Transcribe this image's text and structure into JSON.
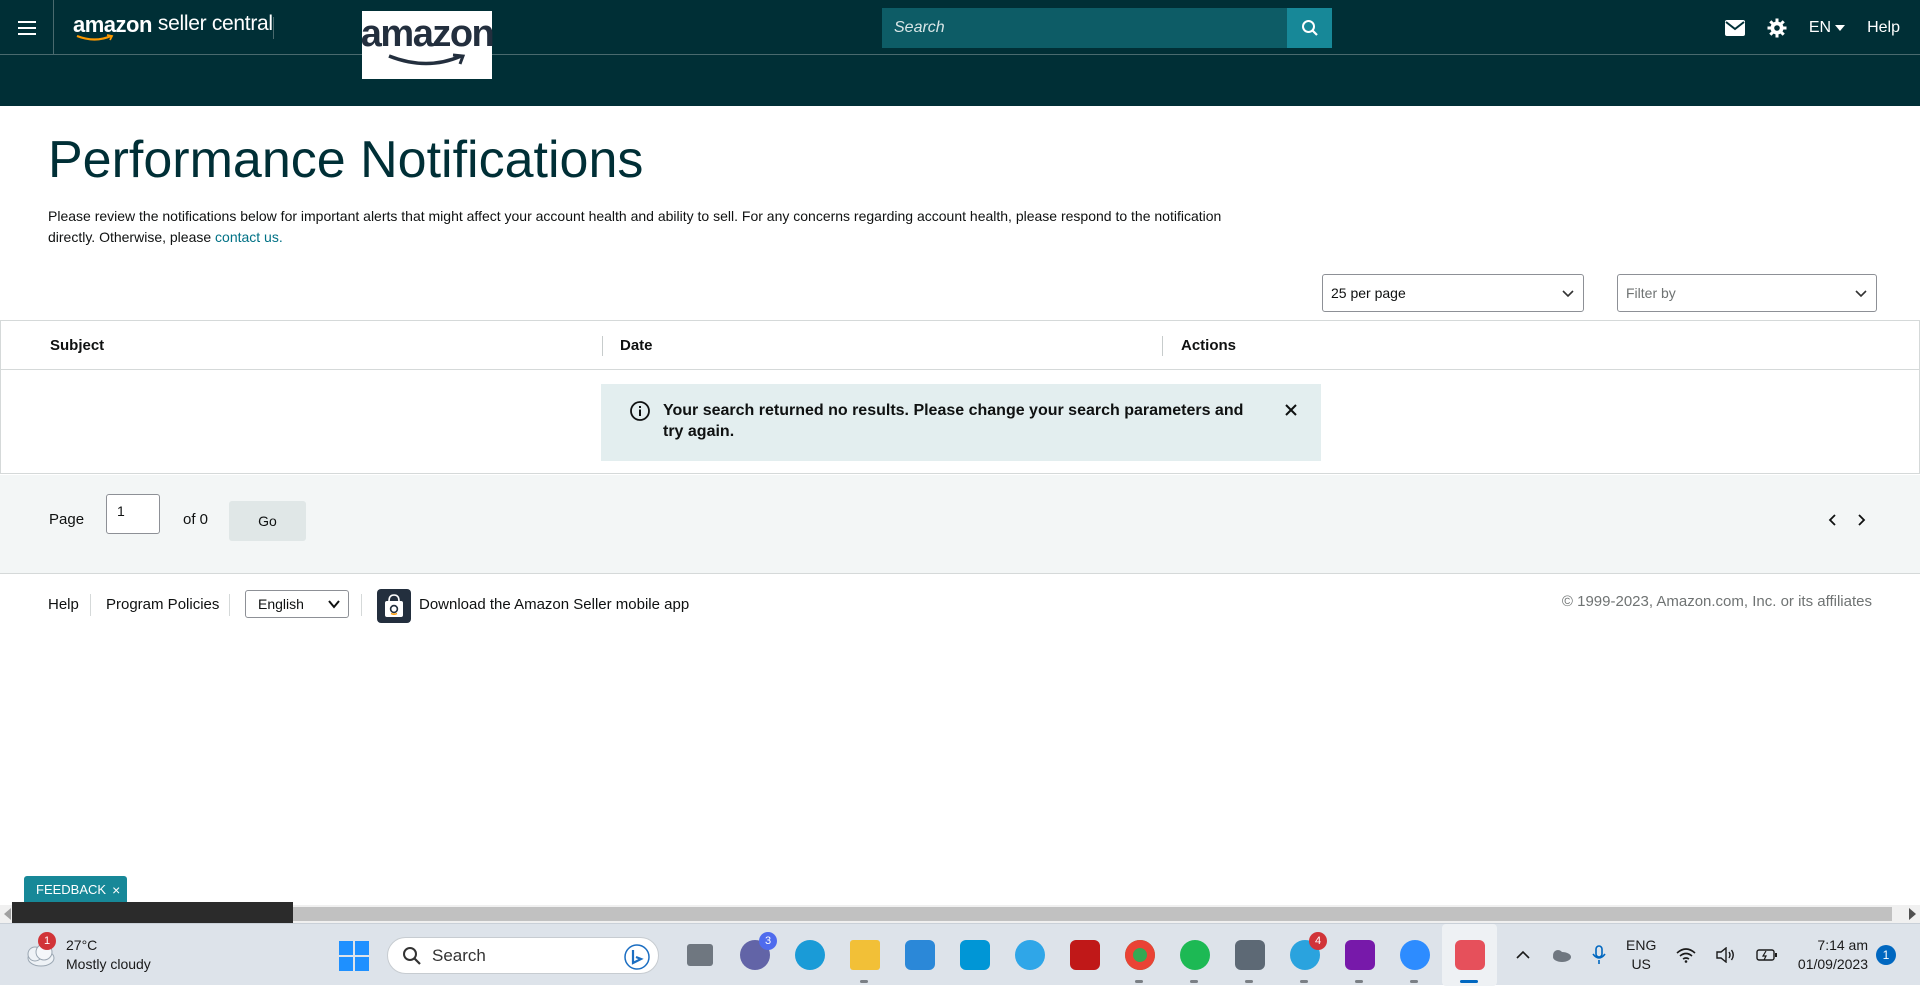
{
  "header": {
    "brand_amazon": "amazon",
    "brand_rest": "seller central",
    "logo_text": "amazon",
    "search_placeholder": "Search",
    "lang_label": "EN",
    "help_label": "Help",
    "icons": {
      "menu": "hamburger-menu-icon",
      "mail": "mail-icon",
      "settings": "gear-icon",
      "search": "search-icon"
    }
  },
  "main": {
    "title": "Performance Notifications",
    "intro_text": "Please review the notifications below for important alerts that might affect your account health and ability to sell. For any concerns regarding account health, please respond to the notification directly. Otherwise, please ",
    "contact_link": "contact us.",
    "per_page_select": "25 per page",
    "filter_select": "Filter by"
  },
  "table": {
    "columns": [
      "Subject",
      "Date",
      "Actions"
    ],
    "rows": [],
    "alert_message": "Your search returned no results. Please change your search parameters and try again."
  },
  "pagination": {
    "page_label": "Page",
    "current_page": "1",
    "of_label": "of 0",
    "go_label": "Go"
  },
  "footer": {
    "help": "Help",
    "program_policies": "Program Policies",
    "language": "English",
    "app_download": "Download the Amazon Seller mobile app",
    "copyright": "© 1999-2023, Amazon.com, Inc. or its affiliates"
  },
  "feedback": {
    "label": "FEEDBACK",
    "close": "×"
  },
  "taskbar": {
    "weather_temp": "27°C",
    "weather_desc": "Mostly cloudy",
    "weather_badge": "1",
    "search_label": "Search",
    "teams_badge": "3",
    "telegram_badge": "4",
    "lang_line1": "ENG",
    "lang_line2": "US",
    "time": "7:14 am",
    "date": "01/09/2023",
    "notification_count": "1"
  },
  "colors": {
    "header_bg": "#002f36",
    "accent_teal": "#178898",
    "title_color": "#002f36",
    "link_color": "#007185",
    "alert_bg": "#e3eeef"
  }
}
